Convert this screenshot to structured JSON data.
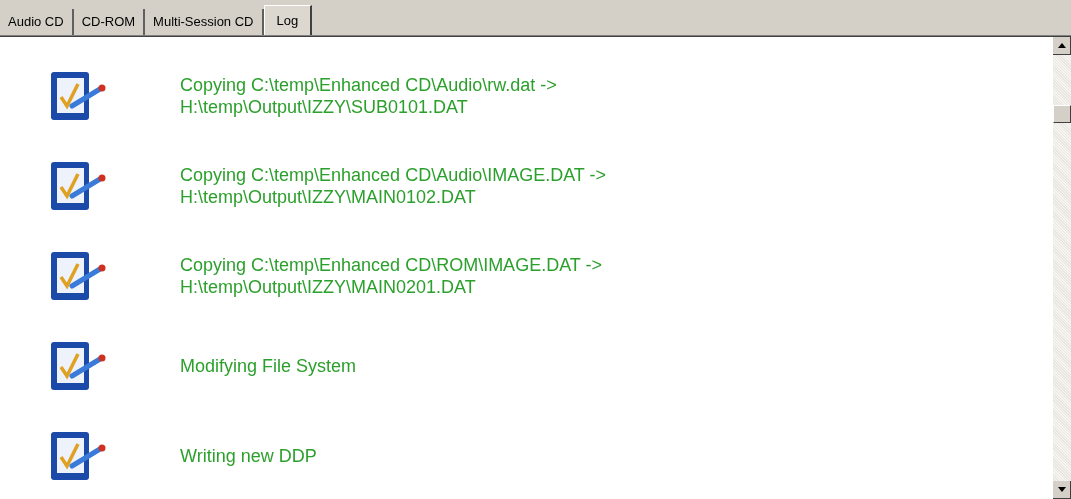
{
  "tabs": [
    {
      "label": "Audio CD",
      "selected": false
    },
    {
      "label": "CD-ROM",
      "selected": false
    },
    {
      "label": "Multi-Session CD",
      "selected": false
    },
    {
      "label": "Log",
      "selected": true
    }
  ],
  "log": {
    "entries": [
      {
        "text": "Copying C:\\temp\\Enhanced CD\\Audio\\rw.dat ->\nH:\\temp\\Output\\IZZY\\SUB0101.DAT"
      },
      {
        "text": "Copying C:\\temp\\Enhanced CD\\Audio\\IMAGE.DAT ->\nH:\\temp\\Output\\IZZY\\MAIN0102.DAT"
      },
      {
        "text": "Copying C:\\temp\\Enhanced CD\\ROM\\IMAGE.DAT ->\nH:\\temp\\Output\\IZZY\\MAIN0201.DAT"
      },
      {
        "text": "Modifying File System"
      },
      {
        "text": "Writing new DDP"
      }
    ]
  }
}
